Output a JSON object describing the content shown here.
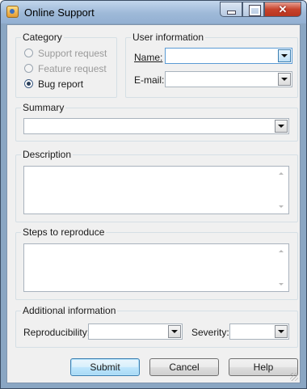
{
  "window": {
    "title": "Online Support",
    "icon": "support-app-icon",
    "minimize_icon": "minimize-icon",
    "maximize_icon": "maximize-icon",
    "close_icon": "close-icon",
    "close_glyph": "✕"
  },
  "category": {
    "legend": "Category",
    "options": [
      {
        "label": "Support request",
        "enabled": false,
        "selected": false
      },
      {
        "label": "Feature request",
        "enabled": false,
        "selected": false
      },
      {
        "label": "Bug report",
        "enabled": true,
        "selected": true
      }
    ]
  },
  "user_info": {
    "legend": "User information",
    "name_label": "Name:",
    "name_value": "",
    "email_label": "E-mail:",
    "email_value": ""
  },
  "summary": {
    "legend": "Summary",
    "value": ""
  },
  "description": {
    "legend": "Description",
    "value": ""
  },
  "steps": {
    "legend": "Steps to reproduce",
    "value": ""
  },
  "additional": {
    "legend": "Additional information",
    "reproducibility_label": "Reproducibility:",
    "reproducibility_value": "",
    "severity_label": "Severity:",
    "severity_value": ""
  },
  "buttons": {
    "submit": "Submit",
    "cancel": "Cancel",
    "help": "Help"
  }
}
